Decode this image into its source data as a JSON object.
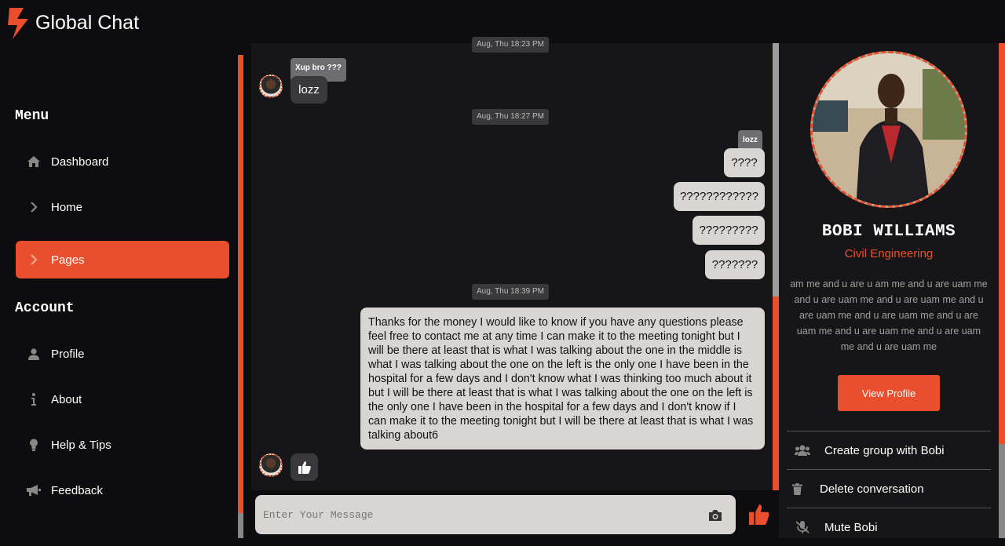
{
  "app": {
    "title": "Global Chat"
  },
  "sidebar": {
    "menu_title": "Menu",
    "account_title": "Account",
    "menu_items": [
      {
        "label": "Dashboard",
        "icon": "home-icon"
      },
      {
        "label": "Home",
        "icon": "chevron-right-icon"
      },
      {
        "label": "Pages",
        "icon": "chevron-right-icon",
        "active": true
      }
    ],
    "account_items": [
      {
        "label": "Profile",
        "icon": "user-icon"
      },
      {
        "label": "About",
        "icon": "info-icon"
      },
      {
        "label": "Help & Tips",
        "icon": "lightbulb-icon"
      },
      {
        "label": "Feedback",
        "icon": "megaphone-icon"
      }
    ]
  },
  "chat": {
    "timestamps": [
      "Aug, Thu 18:23 PM",
      "Aug, Thu 18:27 PM",
      "Aug, Thu 18:39 PM"
    ],
    "incoming_reply_tag": "Xup bro ???",
    "incoming_message": "lozz",
    "outgoing_reply_tag": "lozz",
    "outgoing_messages": [
      "????",
      "????????????",
      "?????????",
      "???????"
    ],
    "long_message": "Thanks for the money I would like to know if you have any questions please feel free to contact me at any time I can make it to the meeting tonight but I will be there at least that is what I was talking about the one in the middle is what I was talking about the one on the left is the only one I have been in the hospital for a few days and I don't know what I was thinking too much about it but I will be there at least that is what I was talking about the one on the left is the only one I have been in the hospital for a few days and I don't know if I can make it to the meeting tonight but I will be there at least that is what I was talking about6",
    "input_placeholder": "Enter Your Message"
  },
  "profile": {
    "name": "BOBI WILLIAMS",
    "department": "Civil Engineering",
    "bio": "am me and u are u am me and u are uam me and u are uam me and u are uam me and u are uam me and u are uam me and u are uam me and u are uam me and u are uam me and u are uam me",
    "view_profile_label": "View Profile",
    "actions": [
      {
        "label": "Create group with Bobi",
        "icon": "users-icon"
      },
      {
        "label": "Delete conversation",
        "icon": "trash-icon"
      },
      {
        "label": "Mute Bobi",
        "icon": "mic-off-icon"
      }
    ]
  },
  "colors": {
    "accent": "#e94e2d",
    "background": "#0d0d0f",
    "panel": "#161618",
    "bubble_light": "#d8d5d3",
    "bubble_dark": "#39393c"
  }
}
